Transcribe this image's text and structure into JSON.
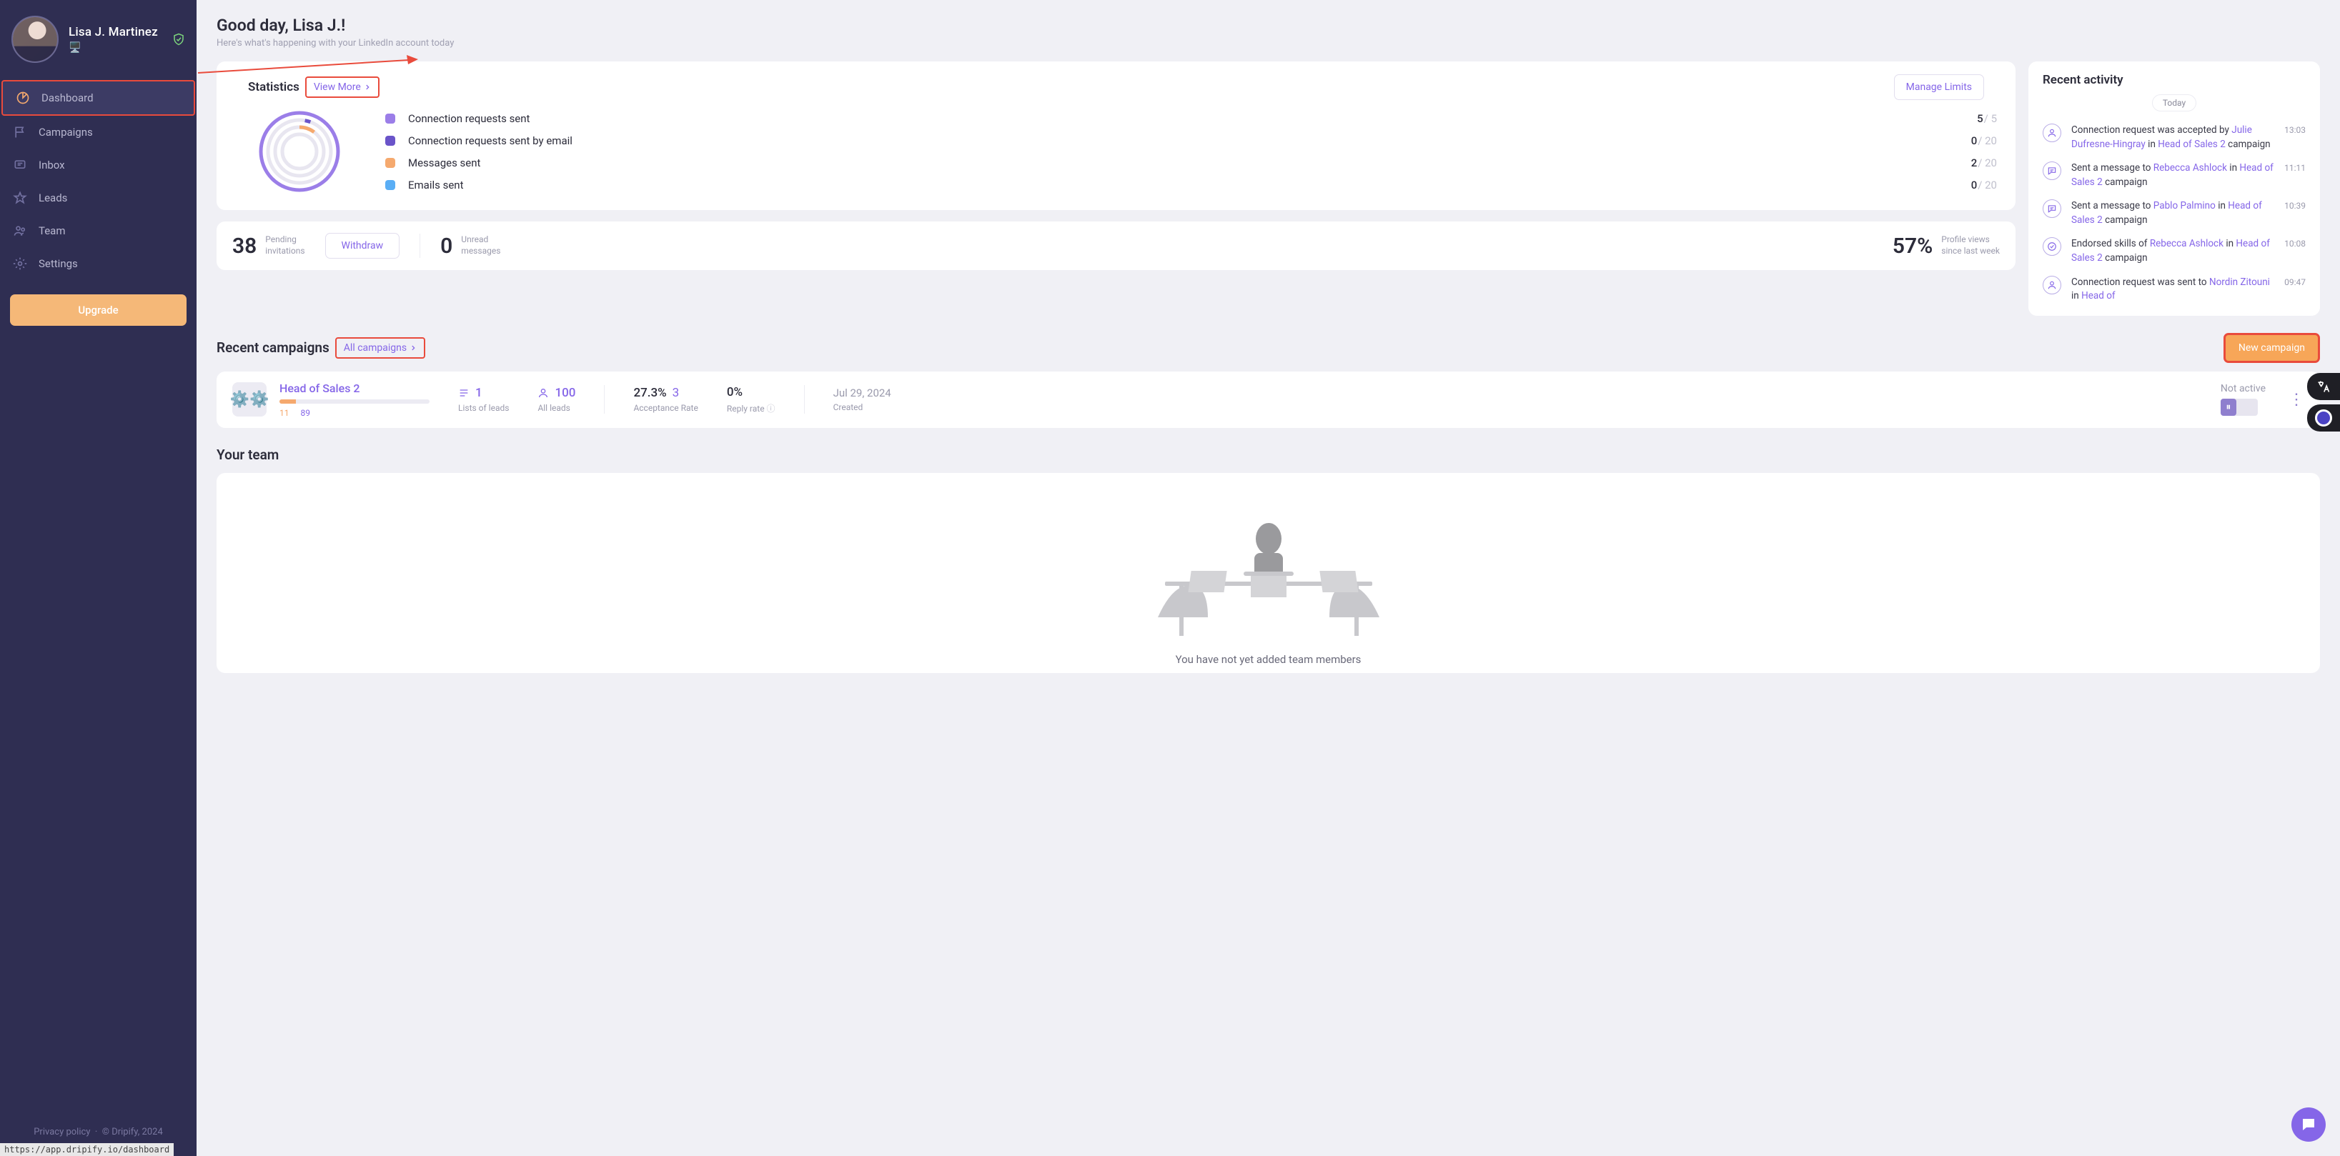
{
  "user": {
    "name": "Lisa J. Martinez"
  },
  "sidebar": {
    "items": [
      {
        "label": "Dashboard",
        "icon": "pie"
      },
      {
        "label": "Campaigns",
        "icon": "flag"
      },
      {
        "label": "Inbox",
        "icon": "chat"
      },
      {
        "label": "Leads",
        "icon": "star"
      },
      {
        "label": "Team",
        "icon": "people"
      },
      {
        "label": "Settings",
        "icon": "gear"
      }
    ],
    "upgrade": "Upgrade",
    "footer_privacy": "Privacy policy",
    "footer_copy": "© Dripify, 2024"
  },
  "greeting": {
    "title": "Good day, Lisa J.!",
    "sub": "Here's what's happening with your LinkedIn account today"
  },
  "stats": {
    "title": "Statistics",
    "view_more": "View More",
    "manage_limits": "Manage Limits",
    "rows": [
      {
        "label": "Connection requests sent",
        "value": "5",
        "max": "/ 5",
        "color": "#9b7ee8"
      },
      {
        "label": "Connection requests sent by email",
        "value": "0",
        "max": "/ 20",
        "color": "#6a54c9"
      },
      {
        "label": "Messages sent",
        "value": "2",
        "max": "/ 20",
        "color": "#f5a96e"
      },
      {
        "label": "Emails sent",
        "value": "0",
        "max": "/ 20",
        "color": "#5aaef5"
      }
    ]
  },
  "kpis": {
    "pending_num": "38",
    "pending_label": "Pending\ninvitations",
    "withdraw": "Withdraw",
    "unread_num": "0",
    "unread_label": "Unread\nmessages",
    "views_num": "57%",
    "views_label": "Profile views\nsince last week"
  },
  "campaigns": {
    "title": "Recent campaigns",
    "all_link": "All campaigns",
    "new_btn": "New campaign",
    "card": {
      "name": "Head of Sales 2",
      "progress_a": "11",
      "progress_b": "89",
      "lists_num": "1",
      "lists_lbl": "Lists of leads",
      "leads_num": "100",
      "leads_lbl": "All leads",
      "acc_num": "27.3%",
      "acc_extra": "3",
      "acc_lbl": "Acceptance Rate",
      "reply_num": "0%",
      "reply_lbl": "Reply rate",
      "created_date": "Jul 29, 2024",
      "created_lbl": "Created",
      "status": "Not active"
    }
  },
  "team": {
    "title": "Your team",
    "empty_msg": "You have not yet added team members"
  },
  "activity": {
    "title": "Recent activity",
    "date": "Today",
    "items": [
      {
        "icon": "user",
        "time": "13:03",
        "prefix": "Connection request was accepted by ",
        "link1": "Julie Dufresne-Hingray",
        "mid": " in ",
        "link2": "Head of Sales 2",
        "suffix": " campaign"
      },
      {
        "icon": "chat",
        "time": "11:11",
        "prefix": "Sent a message to ",
        "link1": "Rebecca Ashlock",
        "mid": " in ",
        "link2": "Head of Sales 2",
        "suffix": " campaign"
      },
      {
        "icon": "chat",
        "time": "10:39",
        "prefix": "Sent a message to ",
        "link1": "Pablo Palmino",
        "mid": " in ",
        "link2": "Head of Sales 2",
        "suffix": " campaign"
      },
      {
        "icon": "check",
        "time": "10:08",
        "prefix": "Endorsed skills of ",
        "link1": "Rebecca Ashlock",
        "mid": " in ",
        "link2": "Head of Sales 2",
        "suffix": " campaign"
      },
      {
        "icon": "user",
        "time": "09:47",
        "prefix": "Connection request was sent to ",
        "link1": "Nordin Zitouni",
        "mid": " in ",
        "link2": "Head of",
        "suffix": ""
      }
    ]
  },
  "status_url": "https://app.dripify.io/dashboard",
  "chart_data": {
    "type": "pie",
    "title": "Daily activity usage",
    "series": [
      {
        "name": "Connection requests sent",
        "value": 5,
        "max": 5,
        "color": "#9b7ee8"
      },
      {
        "name": "Connection requests sent by email",
        "value": 0,
        "max": 20,
        "color": "#6a54c9"
      },
      {
        "name": "Messages sent",
        "value": 2,
        "max": 20,
        "color": "#f5a96e"
      },
      {
        "name": "Emails sent",
        "value": 0,
        "max": 20,
        "color": "#5aaef5"
      }
    ]
  }
}
